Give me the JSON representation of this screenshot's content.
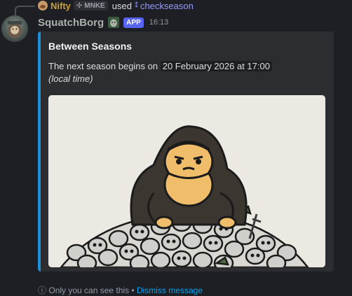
{
  "reply": {
    "user_name": "Nifty",
    "guild_tag": "MNKE",
    "used_text": "used",
    "command": "checkseason"
  },
  "author": {
    "name": "SquatchBorg",
    "app_badge": "APP",
    "timestamp": "16:13"
  },
  "embed": {
    "accent_color": "#1e90d8",
    "title": "Between Seasons",
    "desc_prefix": "The next season begins on",
    "desc_date": "20 February 2026 at 17:00",
    "desc_note": "(local time)"
  },
  "footer": {
    "prefix": "Only you can see this •",
    "link": "Dismiss message"
  },
  "colors": {
    "background": "#1e1f24",
    "embed_background": "#2b2d31",
    "app_badge": "#5865f2",
    "command_link": "#949cf7"
  }
}
